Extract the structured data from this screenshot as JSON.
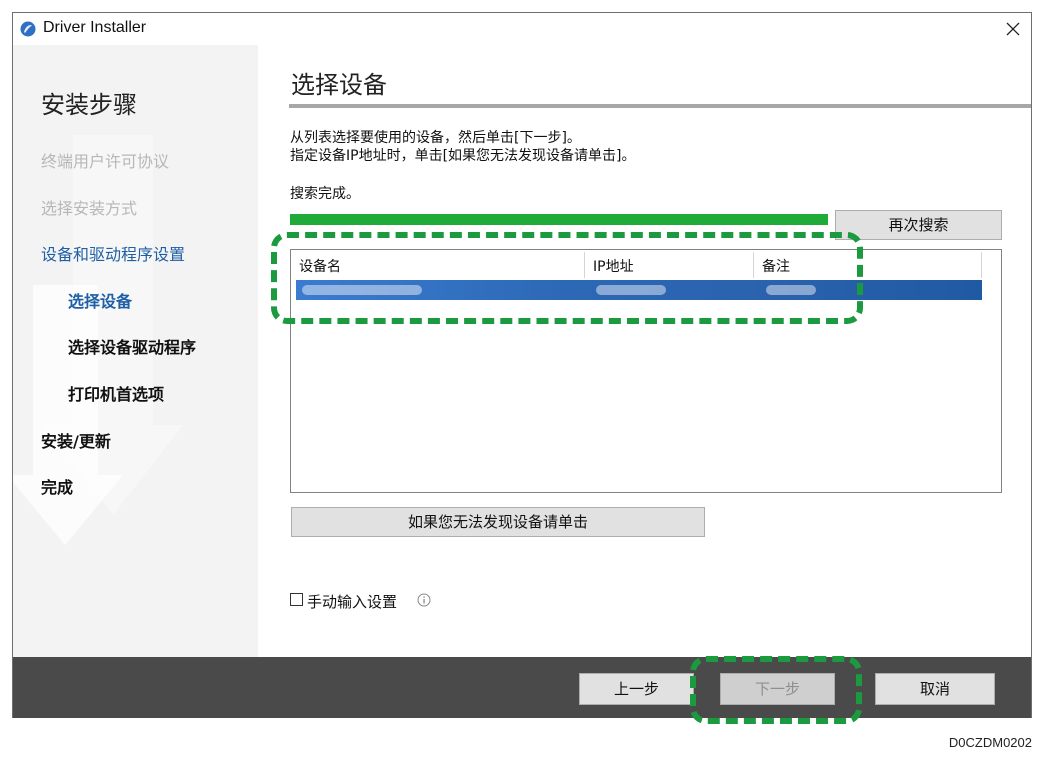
{
  "window": {
    "title": "Driver Installer",
    "icon": "app-orb-icon"
  },
  "sidebar": {
    "heading": "安装步骤",
    "steps": [
      {
        "label": "终端用户许可协议",
        "state": "done"
      },
      {
        "label": "选择安装方式",
        "state": "done"
      },
      {
        "label": "设备和驱动程序设置",
        "state": "current"
      },
      {
        "label": "选择设备",
        "state": "current-sub"
      },
      {
        "label": "选择设备驱动程序",
        "state": "pending"
      },
      {
        "label": "打印机首选项",
        "state": "pending"
      },
      {
        "label": "安装/更新",
        "state": "pending"
      },
      {
        "label": "完成",
        "state": "pending"
      }
    ]
  },
  "main": {
    "title": "选择设备",
    "instruction_line1": "从列表选择要使用的设备，然后单击[下一步]。",
    "instruction_line2": "指定设备IP地址时，单击[如果您无法发现设备请单击]。",
    "status": "搜索完成。",
    "progress": 1.0,
    "search_again_label": "再次搜索",
    "device_list": {
      "columns": [
        "设备名",
        "IP地址",
        "备注"
      ]
    },
    "not_found_button_label": "如果您无法发现设备请单击",
    "manual_input_label": "手动输入设置",
    "manual_input_checked": false
  },
  "footer": {
    "back_label": "上一步",
    "next_label": "下一步",
    "cancel_label": "取消"
  },
  "colors": {
    "accent_green": "#1b9a3f",
    "progress_green": "#1faa3a",
    "selection_blue": "#2a62ad",
    "current_step_blue": "#1f5fa5"
  },
  "document_id": "D0CZDM0202"
}
